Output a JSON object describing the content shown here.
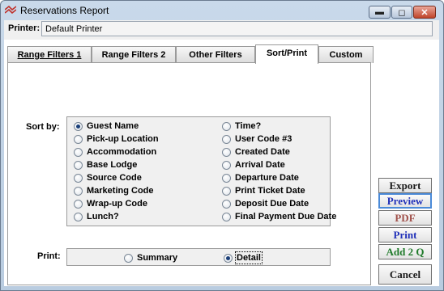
{
  "window": {
    "title": "Reservations Report"
  },
  "printer": {
    "label": "Printer:",
    "value": "Default Printer"
  },
  "tabs": [
    {
      "label": "Range Filters 1"
    },
    {
      "label": "Range Filters 2"
    },
    {
      "label": "Other Filters"
    },
    {
      "label": "Sort/Print",
      "active": true
    },
    {
      "label": "Custom"
    }
  ],
  "sort": {
    "label": "Sort by:",
    "selected": "Guest Name",
    "options_left": [
      "Guest Name",
      "Pick-up Location",
      "Accommodation",
      "Base Lodge",
      "Source Code",
      "Marketing Code",
      "Wrap-up Code",
      "Lunch?"
    ],
    "options_right": [
      "Time?",
      "User Code #3",
      "Created Date",
      "Arrival Date",
      "Departure Date",
      "Print Ticket Date",
      "Deposit Due Date",
      "Final Payment Due Date"
    ]
  },
  "print": {
    "label": "Print:",
    "options": [
      "Summary",
      "Detail"
    ],
    "selected": "Detail"
  },
  "buttons": {
    "export": {
      "label": "Export",
      "color": "#1a1a1a"
    },
    "preview": {
      "label": "Preview",
      "color": "#1f2fb8"
    },
    "pdf": {
      "label": "PDF",
      "color": "#a0504a"
    },
    "print": {
      "label": "Print",
      "color": "#1f2fb8"
    },
    "add2q": {
      "label": "Add 2 Q",
      "color": "#1f7a2a"
    },
    "cancel": {
      "label": "Cancel",
      "color": "#1a1a1a"
    }
  },
  "icons": {
    "app": "app-icon",
    "minimize": "minimize-icon",
    "maximize": "maximize-icon",
    "close": "close-icon"
  }
}
